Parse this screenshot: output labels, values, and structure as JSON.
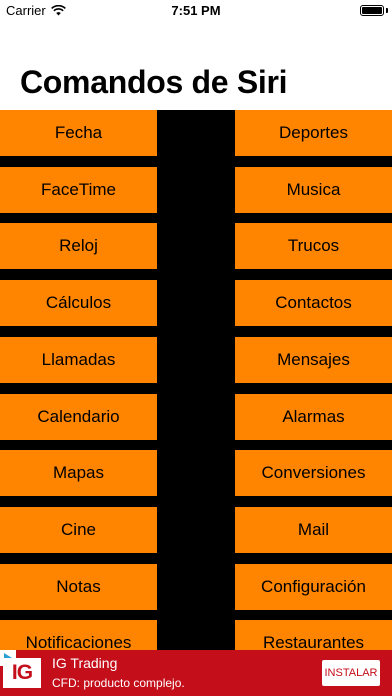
{
  "status_bar": {
    "carrier": "Carrier",
    "time": "7:51 PM"
  },
  "title": "Comandos de Siri",
  "grid": {
    "left": [
      "Fecha",
      "FaceTime",
      "Reloj",
      "Cálculos",
      "Llamadas",
      "Calendario",
      "Mapas",
      "Cine",
      "Notas",
      "Notificaciones"
    ],
    "right": [
      "Deportes",
      "Musica",
      "Trucos",
      "Contactos",
      "Mensajes",
      "Alarmas",
      "Conversiones",
      "Mail",
      "Configuración",
      "Restaurantes"
    ]
  },
  "ad": {
    "logo": "IG",
    "title": "IG Trading",
    "subtitle": "CFD: producto complejo.",
    "button": "INSTALAR"
  },
  "colors": {
    "button_bg": "#ff8400",
    "grid_bg": "#000000",
    "ad_bg": "#c40e1a"
  }
}
